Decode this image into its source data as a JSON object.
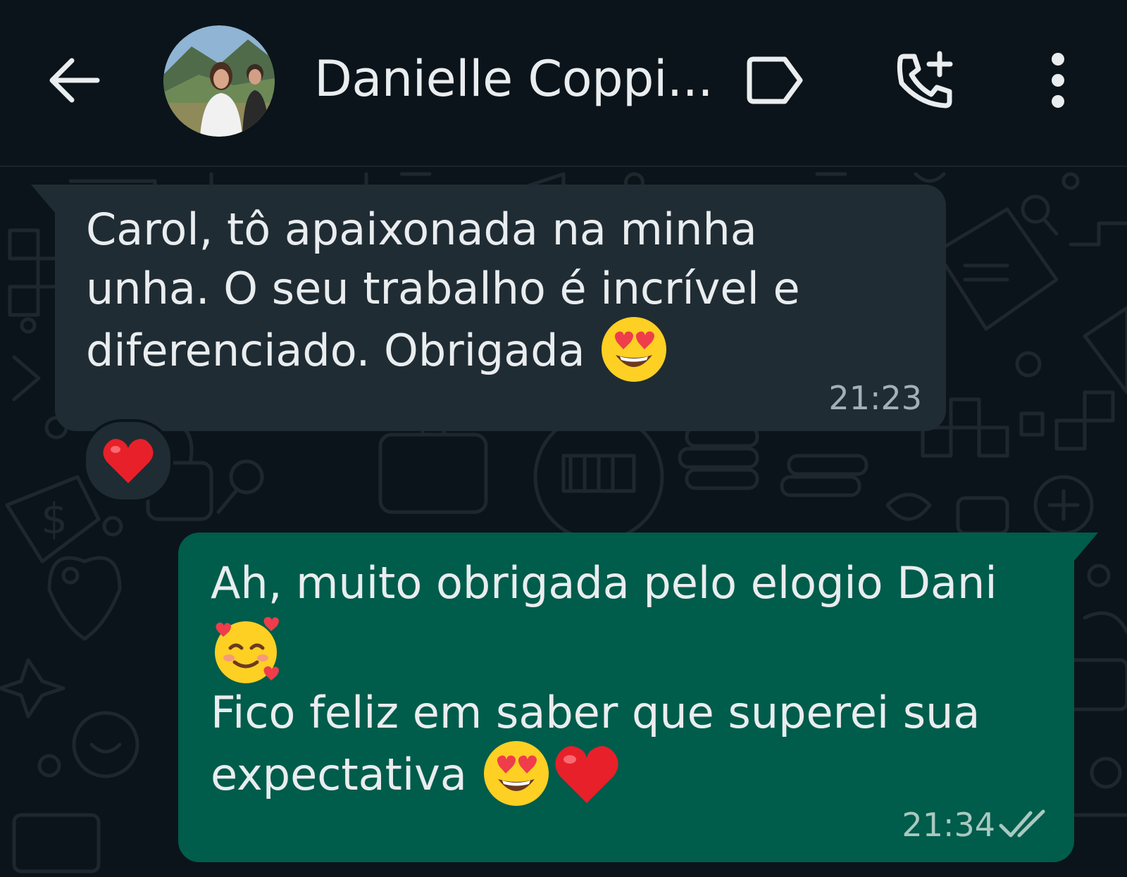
{
  "header": {
    "contact_name": "Danielle Coppi...",
    "icons": [
      "back-arrow-icon",
      "label-tag-icon",
      "add-call-icon",
      "more-vert-icon"
    ]
  },
  "messages": [
    {
      "direction": "incoming",
      "lines": [
        "Carol, tô apaixonada na minha",
        "unha. O seu trabalho é incrível e",
        "diferenciado. Obrigada"
      ],
      "emoji": [
        "heart-eyes-emoji"
      ],
      "time": "21:23",
      "reaction": "red-heart-emoji"
    },
    {
      "direction": "outgoing",
      "line1": "Ah, muito obrigada pelo elogio Dani",
      "line2_emoji": "smiling-face-with-hearts-emoji",
      "line3": "Fico feliz em saber que superei sua",
      "line4": "expectativa",
      "line4_emoji": [
        "heart-eyes-emoji",
        "red-heart-emoji"
      ],
      "time": "21:34",
      "status": "read-double-check-icon"
    }
  ],
  "colors": {
    "background": "#0b141a",
    "incoming_bubble": "#202c33",
    "outgoing_bubble": "#005c4b",
    "text": "#e9edef",
    "read_ticks": "#a8c9c1"
  }
}
